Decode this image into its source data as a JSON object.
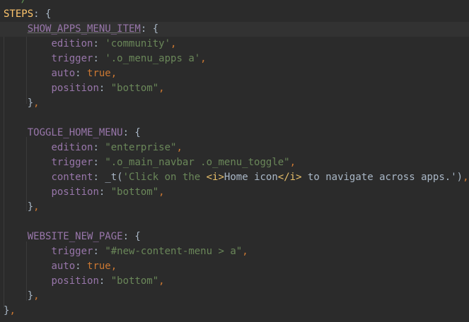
{
  "editor": {
    "comment_tail": "*/",
    "root_key": "STEPS",
    "blocks": [
      {
        "key": "SHOW_APPS_MENU_ITEM",
        "props": [
          {
            "name": "edition",
            "value": "'community'"
          },
          {
            "name": "trigger",
            "value": "'.o_menu_apps a'"
          },
          {
            "name": "auto",
            "value": "true"
          },
          {
            "name": "position",
            "value": "\"bottom\""
          }
        ]
      },
      {
        "key": "TOGGLE_HOME_MENU",
        "props": [
          {
            "name": "edition",
            "value": "\"enterprise\""
          },
          {
            "name": "trigger",
            "value": "\".o_main_navbar .o_menu_toggle\""
          },
          {
            "name": "content",
            "func": "_t(",
            "str_a": "'Click on the ",
            "tag_open": "<i>",
            "str_b": "Home icon",
            "tag_close": "</i>",
            "str_c": " to navigate across apps.'",
            "func_close": ")"
          },
          {
            "name": "position",
            "value": "\"bottom\""
          }
        ]
      },
      {
        "key": "WEBSITE_NEW_PAGE",
        "props": [
          {
            "name": "trigger",
            "value": "\"#new-content-menu > a\""
          },
          {
            "name": "auto",
            "value": "true"
          },
          {
            "name": "position",
            "value": "\"bottom\""
          }
        ]
      }
    ],
    "colors": {
      "background": "#2b2b2b",
      "current_line": "#323232",
      "key": "#9876aa",
      "string": "#6a8759",
      "keyword": "#cc7832",
      "plain": "#a9b7c6"
    }
  }
}
